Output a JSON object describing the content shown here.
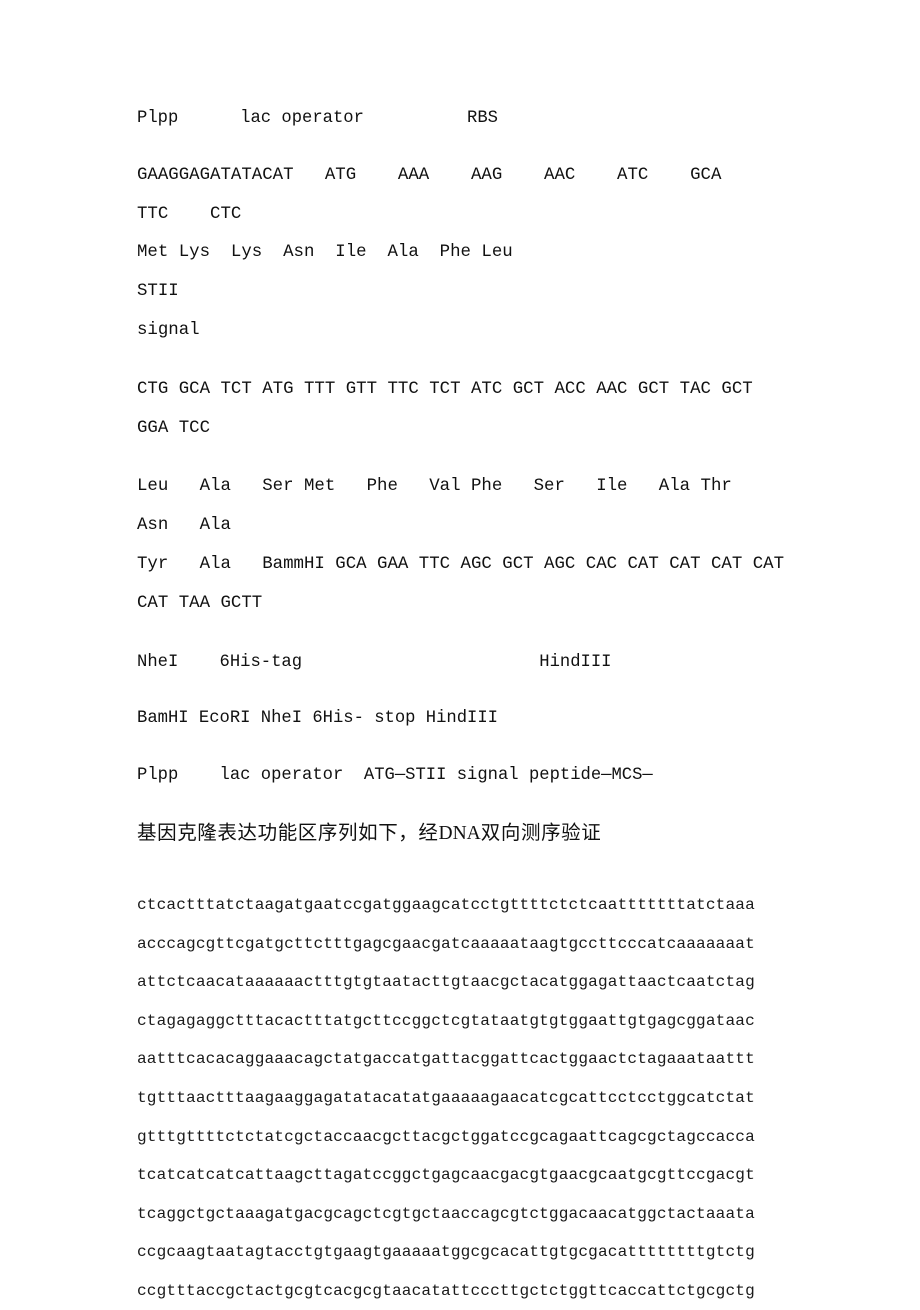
{
  "document": {
    "type": "plain-text-document",
    "background_color": "#ffffff",
    "text_color": "#111111"
  },
  "annotations": {
    "row1": "Plpp      lac operator          RBS",
    "nhei_6his_hindiii": "NheI    6His-tag                       HindIII",
    "sites_summary": "BamHI EcoRI NheI 6His- stop HindIII",
    "construct_map": "Plpp    lac operator  ATG—STII signal peptide—MCS—"
  },
  "sequence_blocks": [
    {
      "name": "rbs-start-codons",
      "dna": "GAAGGAGATATACAT   ATG    AAA    AAG    AAC    ATC    GCA    TTC    CTC",
      "protein": "Met Lys  Lys  Asn  Ile  Ala  Phe Leu                              STII",
      "note": "signal"
    },
    {
      "name": "stii-signal-peptide",
      "dna": "CTG GCA TCT ATG TTT GTT TTC TCT ATC GCT ACC AAC GCT TAC GCT GGA TCC",
      "protein_line1": "Leu   Ala   Ser Met   Phe   Val Phe   Ser   Ile   Ala Thr   Asn   Ala",
      "protein_line2": "Tyr   Ala   BammHI GCA GAA TTC AGC GCT AGC CAC CAT CAT CAT CAT",
      "protein_line3": "CAT TAA GCTT"
    }
  ],
  "chinese_heading": {
    "prefix": "基因克隆表达功能区序列如下，经",
    "latin": "DNA",
    "suffix": "双向测序验证"
  },
  "dna_sequence": {
    "lines": [
      "ctcactttatctaagatgaatccgatggaagcatcctgttttctctcaatttttttatctaaa",
      "acccagcgttcgatgcttctttgagcgaacgatcaaaaataagtgccttcccatcaaaaaaat",
      "attctcaacataaaaaactttgtgtaatacttgtaacgctacatggagattaactcaatctag",
      "ctagagaggctttacactttatgcttccggctcgtataatgtgtggaattgtgagcggataac",
      "aatttcacacaggaaacagctatgaccatgattacggattcactggaactctagaaataattt",
      "tgtttaactttaagaaggagatatacatatgaaaaagaacatcgcattcctcctggcatctat",
      "gtttgttttctctatcgctaccaacgcttacgctggatccgcagaattcagcgctagccacca",
      "tcatcatcatcattaagcttagatccggctgagcaacgacgtgaacgcaatgcgttccgacgt",
      "tcaggctgctaaagatgacgcagctcgtgctaaccagcgtctggacaacatggctactaaata",
      "ccgcaagtaatagtacctgtgaagtgaaaaatggcgcacattgtgcgacattttttttgtctg",
      "ccgtttaccgctactgcgtcacgcgtaacatattcccttgctctggttcaccattctgcgctg"
    ]
  }
}
